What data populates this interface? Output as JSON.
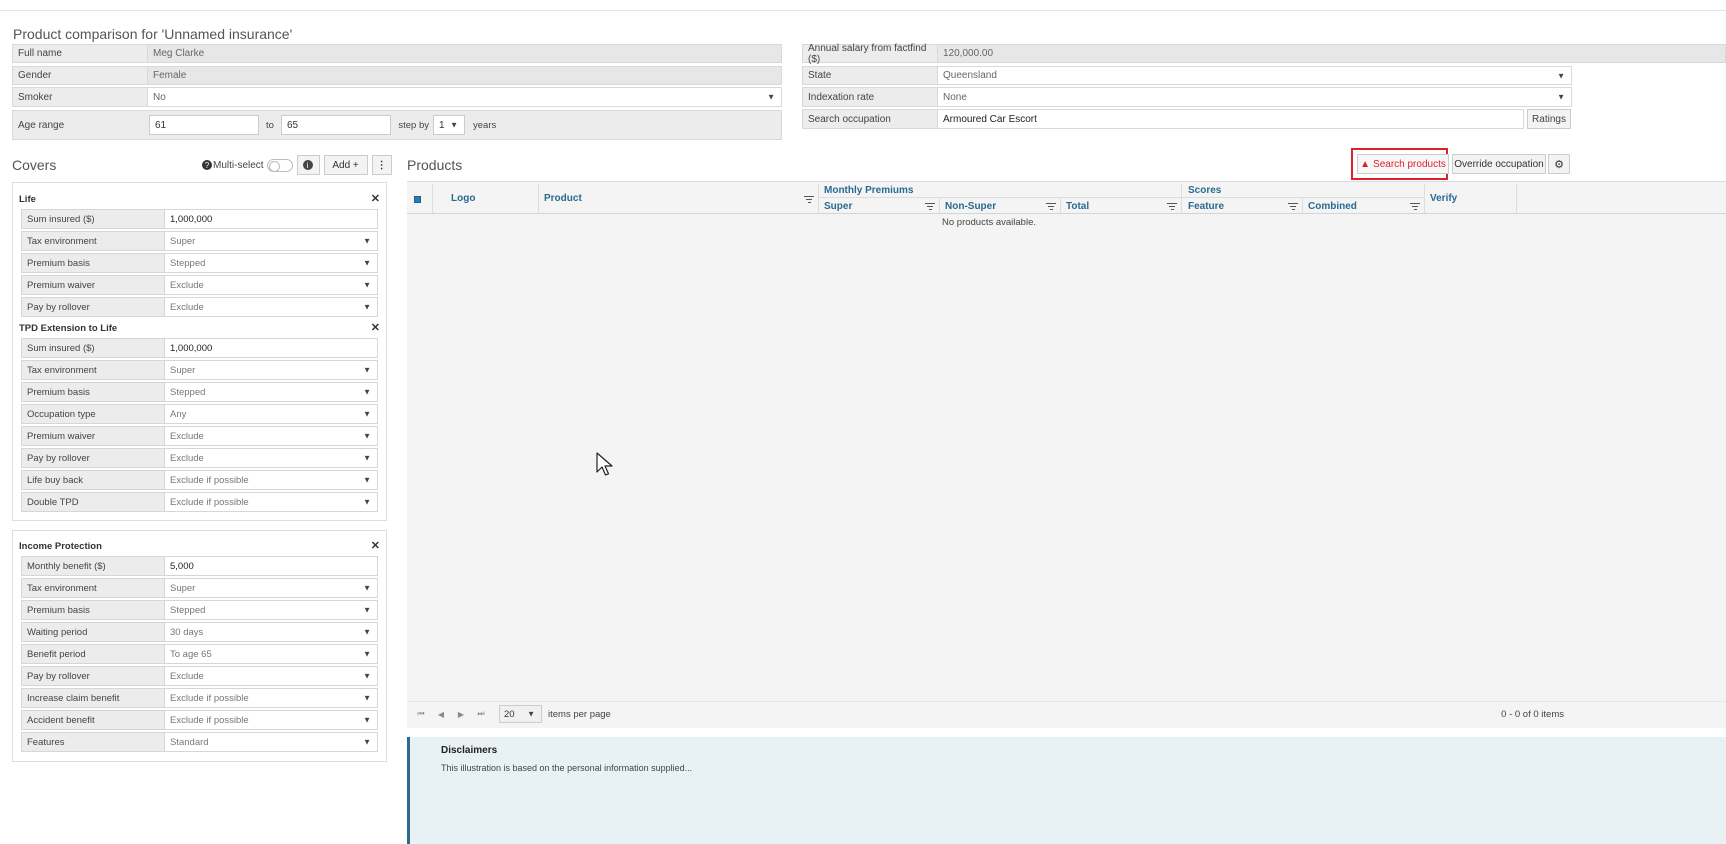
{
  "page": {
    "title": "Product comparison for 'Unnamed insurance'"
  },
  "factfind": {
    "full_name_label": "Full name",
    "full_name": "Meg Clarke",
    "gender_label": "Gender",
    "gender": "Female",
    "smoker_label": "Smoker",
    "smoker": "No",
    "age_range_label": "Age range",
    "age_from": "61",
    "age_to_label": "to",
    "age_to": "65",
    "step_by_label": "step by",
    "step_by": "1",
    "years_label": "years",
    "salary_label": "Annual salary from factfind ($)",
    "salary": "120,000.00",
    "state_label": "State",
    "state": "Queensland",
    "indexation_label": "Indexation rate",
    "indexation": "None",
    "occupation_label": "Search occupation",
    "occupation": "Armoured Car Escort",
    "ratings_label": "Ratings"
  },
  "covers": {
    "heading": "Covers",
    "multi_select_label": "Multi-select",
    "add_label": "Add +",
    "life": {
      "title": "Life",
      "rows": [
        {
          "label": "Sum insured ($)",
          "value": "1,000,000"
        },
        {
          "label": "Tax environment",
          "value": "Super"
        },
        {
          "label": "Premium basis",
          "value": "Stepped"
        },
        {
          "label": "Premium waiver",
          "value": "Exclude"
        },
        {
          "label": "Pay by rollover",
          "value": "Exclude"
        }
      ]
    },
    "tpd": {
      "title": "TPD Extension to Life",
      "rows": [
        {
          "label": "Sum insured ($)",
          "value": "1,000,000"
        },
        {
          "label": "Tax environment",
          "value": "Super"
        },
        {
          "label": "Premium basis",
          "value": "Stepped"
        },
        {
          "label": "Occupation type",
          "value": "Any"
        },
        {
          "label": "Premium waiver",
          "value": "Exclude"
        },
        {
          "label": "Pay by rollover",
          "value": "Exclude"
        },
        {
          "label": "Life buy back",
          "value": "Exclude if possible"
        },
        {
          "label": "Double TPD",
          "value": "Exclude if possible"
        }
      ]
    },
    "ip": {
      "title": "Income Protection",
      "rows": [
        {
          "label": "Monthly benefit ($)",
          "value": "5,000"
        },
        {
          "label": "Tax environment",
          "value": "Super"
        },
        {
          "label": "Premium basis",
          "value": "Stepped"
        },
        {
          "label": "Waiting period",
          "value": "30 days"
        },
        {
          "label": "Benefit period",
          "value": "To age 65"
        },
        {
          "label": "Pay by rollover",
          "value": "Exclude"
        },
        {
          "label": "Increase claim benefit",
          "value": "Exclude if possible"
        },
        {
          "label": "Accident benefit",
          "value": "Exclude if possible"
        },
        {
          "label": "Features",
          "value": "Standard"
        }
      ]
    }
  },
  "products": {
    "heading": "Products",
    "search_label": "Search products",
    "override_label": "Override occupation",
    "columns": {
      "logo": "Logo",
      "product": "Product",
      "monthly_premiums": "Monthly Premiums",
      "super": "Super",
      "non_super": "Non-Super",
      "total": "Total",
      "scores": "Scores",
      "feature": "Feature",
      "combined": "Combined",
      "verify": "Verify"
    },
    "empty": "No products available.",
    "page_size": "20",
    "items_per_page": "items per page",
    "count": "0 - 0 of 0 items"
  },
  "disclaimer": {
    "title": "Disclaimers",
    "text": "This illustration is based on the personal information supplied..."
  },
  "colors": {
    "accent": "#2a6a8f",
    "alert": "#d8232a"
  }
}
